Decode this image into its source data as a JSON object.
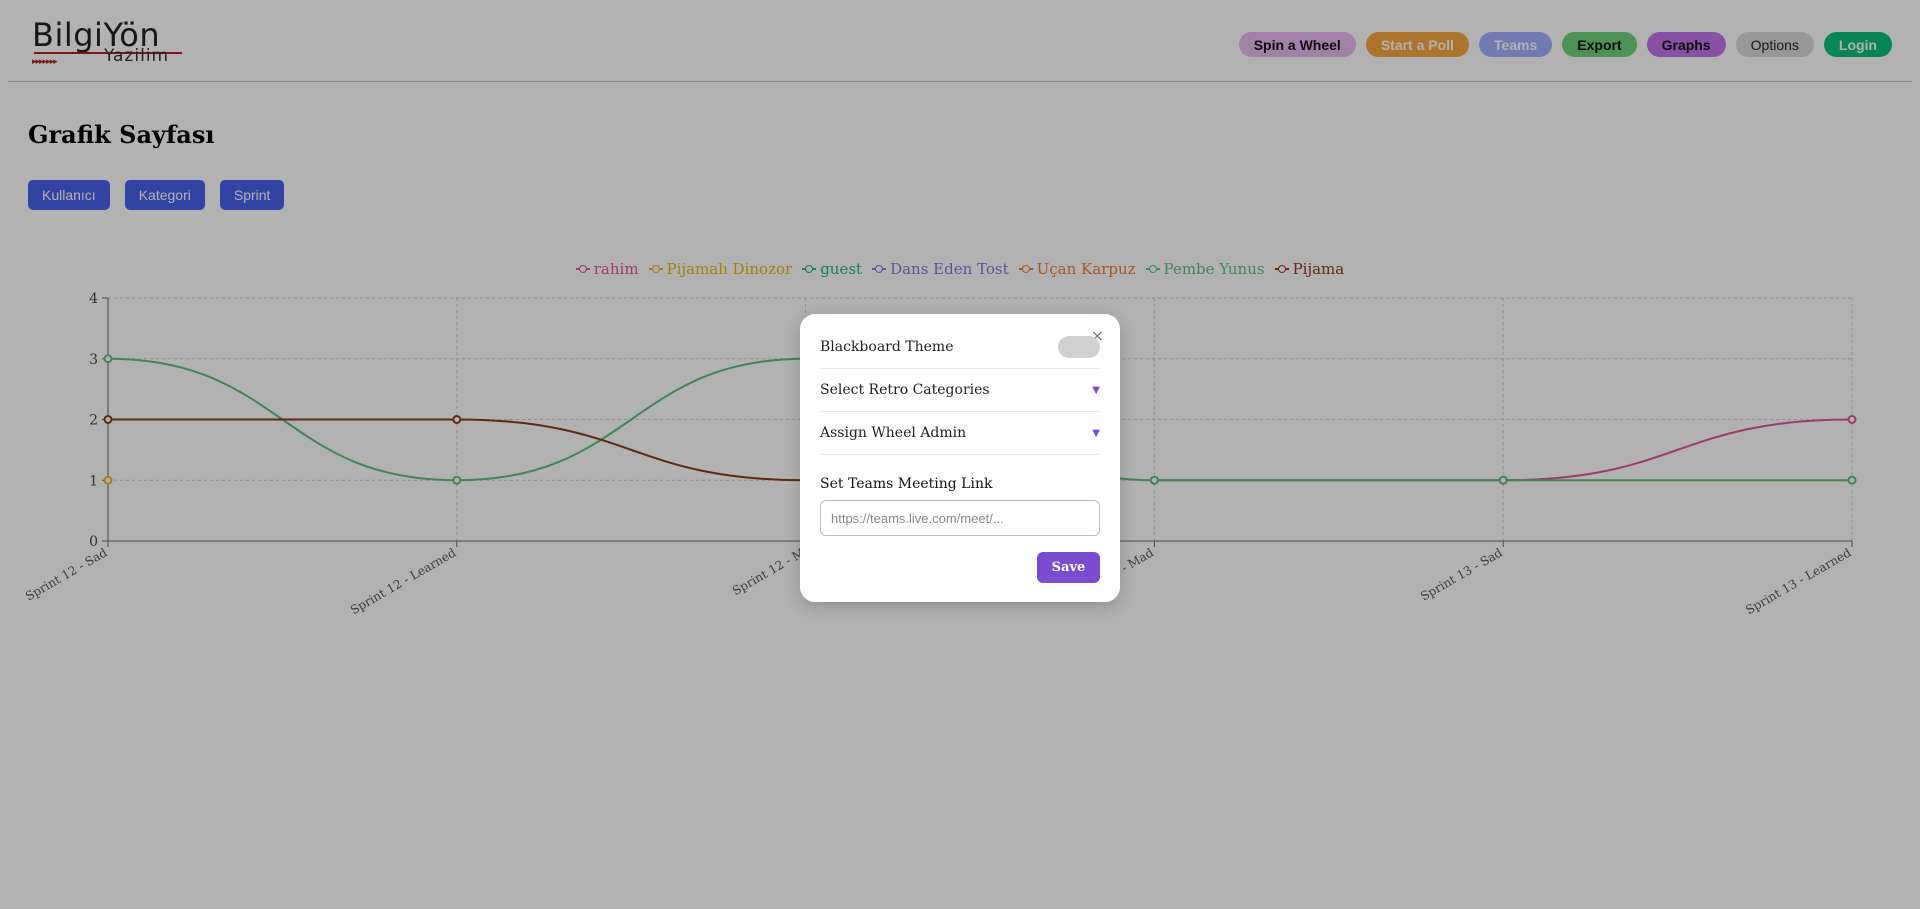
{
  "logo": {
    "main": "BilgiYön",
    "sub": "Yazilim",
    "arrows": "▸▸▸▸▸▸▸"
  },
  "nav": [
    {
      "label": "Spin a Wheel",
      "bg": "#e7b9ee",
      "color": "#111111"
    },
    {
      "label": "Start a Poll",
      "bg": "#f7a741",
      "color": "#ffffff"
    },
    {
      "label": "Teams",
      "bg": "#a3b1ff",
      "color": "#ffffff"
    },
    {
      "label": "Export",
      "bg": "#72d27a",
      "color": "#111111"
    },
    {
      "label": "Graphs",
      "bg": "#c374ec",
      "color": "#111111"
    },
    {
      "label": "Options",
      "bg": "#d9d9d9",
      "color": "#222222"
    },
    {
      "label": "Login",
      "bg": "#0cbf7a",
      "color": "#ffffff"
    }
  ],
  "page": {
    "title": "Grafik Sayfası"
  },
  "tabs": [
    "Kullanıcı",
    "Kategori",
    "Sprint"
  ],
  "chart_data": {
    "type": "line",
    "x": [
      "Sprint 12 - Sad",
      "Sprint 12 - Learned",
      "Sprint 12 - Mad",
      "Sprint 13 - Mad",
      "Sprint 13 - Sad",
      "Sprint 13 - Learned"
    ],
    "x_visible_labels": [
      "Sprint 12 - Sad",
      "Sprint 12 - Learned",
      "Sprint 12 - M",
      "13 - Mad",
      "Sprint 13 - Sad",
      "Sprint 13 - Learned"
    ],
    "ylim": [
      0,
      4
    ],
    "yticks": [
      "0",
      "1",
      "2",
      "3",
      "4"
    ],
    "grid": true,
    "legend_position": "top-center",
    "series": [
      {
        "name": "rahim",
        "color": "#e6529b",
        "values": [
          null,
          null,
          null,
          1,
          1,
          2
        ]
      },
      {
        "name": "Pijamalı Dinozor",
        "color": "#e8b70d",
        "values": [
          1,
          null,
          null,
          null,
          null,
          null
        ]
      },
      {
        "name": "guest",
        "color": "#20b28c",
        "values": []
      },
      {
        "name": "Dans Eden Tost",
        "color": "#8a74d8",
        "values": []
      },
      {
        "name": "Uçan Karpuz",
        "color": "#f07a35",
        "values": []
      },
      {
        "name": "Pembe Yunus",
        "color": "#5fbd77",
        "values": [
          3,
          1,
          3,
          1,
          1,
          1
        ]
      },
      {
        "name": "Pijama",
        "color": "#8b3a14",
        "values": [
          2,
          2,
          1,
          null,
          null,
          null
        ]
      }
    ]
  },
  "modal": {
    "close": "×",
    "blackboard_label": "Blackboard Theme",
    "retro_label": "Select Retro Categories",
    "wheel_label": "Assign Wheel Admin",
    "caret": "▼",
    "teams_link_label": "Set Teams Meeting Link",
    "teams_link_placeholder": "https://teams.live.com/meet/...",
    "teams_link_value": "",
    "save": "Save"
  }
}
